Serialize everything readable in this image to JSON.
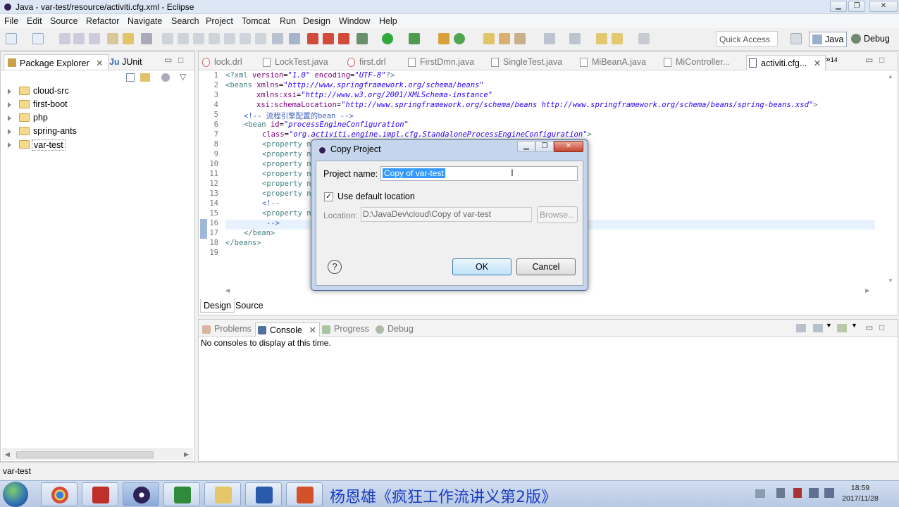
{
  "window": {
    "title": "Java - var-test/resource/activiti.cfg.xml - Eclipse"
  },
  "menu": [
    "File",
    "Edit",
    "Source",
    "Refactor",
    "Navigate",
    "Search",
    "Project",
    "Tomcat",
    "Run",
    "Design",
    "Window",
    "Help"
  ],
  "toolbar": {
    "quick_access": "Quick Access",
    "perspective_java": "Java",
    "perspective_debug": "Debug"
  },
  "package_explorer": {
    "tabs": [
      "Package Explorer",
      "JUnit"
    ],
    "items": [
      "cloud-src",
      "first-boot",
      "php",
      "spring-ants",
      "var-test"
    ]
  },
  "editor": {
    "tabs": [
      "lock.drl",
      "LockTest.java",
      "first.drl",
      "FirstDmn.java",
      "SingleTest.java",
      "MiBeanA.java",
      "MiController...",
      "activiti.cfg..."
    ],
    "overflow_count": "14",
    "bottom_tabs": [
      "Design",
      "Source"
    ],
    "lines": {
      "l1a": "<?xml ",
      "l1b": "version",
      "l1c": "=",
      "l1d": "\"1.0\"",
      "l1e": " ",
      "l1f": "encoding",
      "l1g": "=",
      "l1h": "\"UTF-8\"",
      "l1i": "?>",
      "l2a": "<beans ",
      "l2b": "xmlns",
      "l2c": "=",
      "l2d": "\"http://www.springframework.org/schema/beans\"",
      "l3a": "xmlns:xsi",
      "l3b": "=",
      "l3c": "\"http://www.w3.org/2001/XMLSchema-instance\"",
      "l4a": "xsi:schemaLocation",
      "l4b": "=",
      "l4c": "\"http://www.springframework.org/schema/beans http://www.springframework.org/schema/beans/spring-beans.xsd\"",
      "l4d": ">",
      "l5": "<!-- 流程引擎配置的bean -->",
      "l6a": "<bean ",
      "l6b": "id",
      "l6c": "=",
      "l6d": "\"processEngineConfiguration\"",
      "l7a": "class",
      "l7b": "=",
      "l7c": "\"org.activiti.engine.impl.cfg.StandaloneProcessEngineConfiguration\"",
      "l7d": ">",
      "prop": "<property n",
      "l14": "<!--",
      "l16": "-->",
      "l17": "</bean>",
      "l18": "</beans>"
    }
  },
  "console": {
    "tabs": [
      "Problems",
      "Console",
      "Progress",
      "Debug"
    ],
    "message": "No consoles to display at this time."
  },
  "status": {
    "text": "var-test"
  },
  "dialog": {
    "title": "Copy Project",
    "project_name_label": "Project name:",
    "project_name_value": "Copy of var-test",
    "use_default_label": "Use default location",
    "location_label": "Location:",
    "location_value": "D:\\JavaDev\\cloud\\Copy of var-test",
    "browse": "Browse...",
    "ok": "OK",
    "cancel": "Cancel"
  },
  "taskbar": {
    "caption": "杨恩雄《疯狂工作流讲义第2版》",
    "time": "18:59",
    "date": "2017/11/28"
  }
}
